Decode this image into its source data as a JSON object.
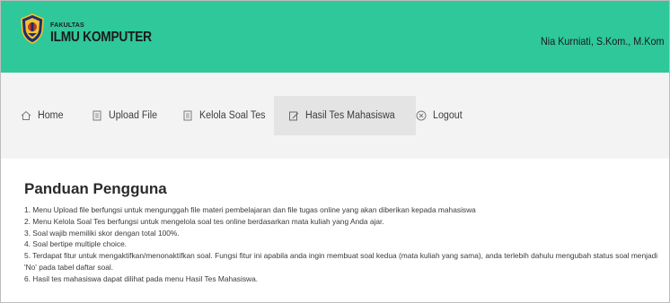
{
  "header": {
    "brand_small": "FAKULTAS",
    "brand_big": "ILMU KOMPUTER",
    "user_name": "Nia Kurniati, S.Kom., M.Kom",
    "logo_icon": "university-crest-icon",
    "bar_color": "#2ec89a"
  },
  "nav": {
    "items": [
      {
        "label": "Home",
        "icon": "home-icon"
      },
      {
        "label": "Upload File",
        "icon": "file-icon"
      },
      {
        "label": "Kelola Soal Tes",
        "icon": "file-icon"
      },
      {
        "label": "Hasil Tes Mahasiswa",
        "icon": "edit-icon"
      },
      {
        "label": "Logout",
        "icon": "close-circle-icon"
      }
    ],
    "active": "Hasil Tes Mahasiswa"
  },
  "main": {
    "title": "Panduan Pengguna",
    "items": [
      "1. Menu Upload file berfungsi untuk mengunggah file materi pembelajaran dan file tugas online yang akan diberikan kepada mahasiswa",
      "2. Menu Kelola Soal Tes berfungsi untuk mengelola soal tes online berdasarkan mata kuliah yang Anda ajar.",
      "3. Soal wajib memiliki skor dengan total 100%.",
      "4. Soal bertipe multiple choice.",
      "5. Terdapat fitur untuk mengaktifkan/menonaktifkan soal. Fungsi fitur ini apabila anda ingin membuat soal kedua (mata kuliah yang sama), anda terlebih dahulu mengubah status soal menjadi 'No' pada tabel daftar soal.",
      "6. Hasil tes mahasiswa dapat dilihat pada menu Hasil Tes Mahasiswa."
    ]
  }
}
